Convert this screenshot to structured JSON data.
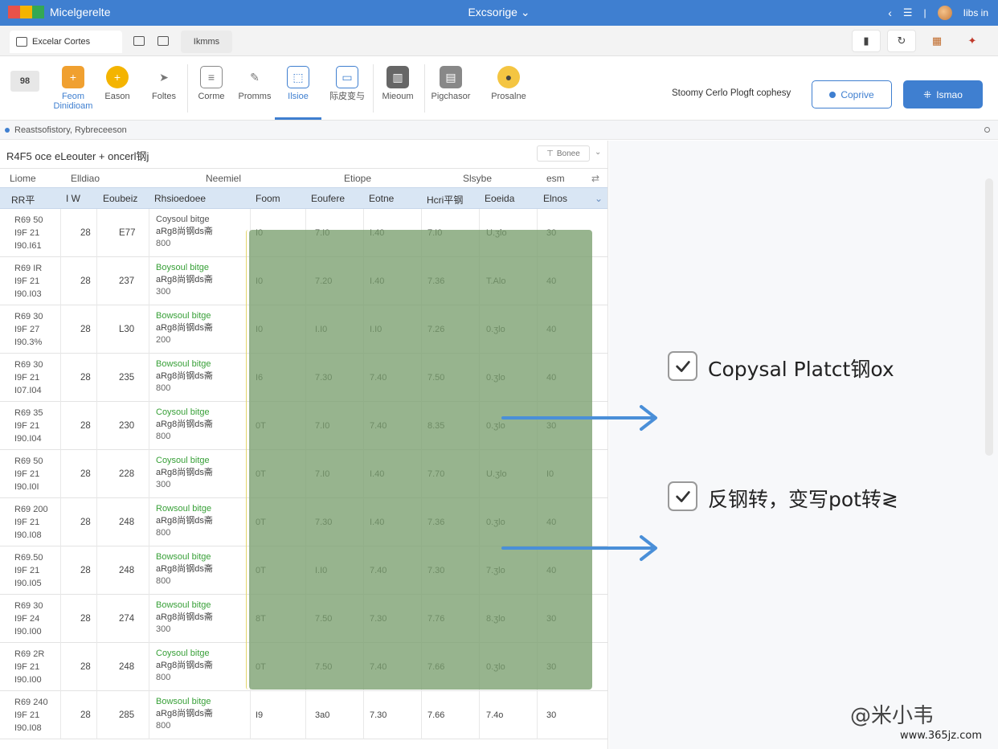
{
  "app": {
    "name": "Micelgerelte",
    "window_title": "Excsorige",
    "user": "Iibs in"
  },
  "colors": {
    "accent": "#3f7fd0",
    "highlight": "#7a9f6e",
    "link_green": "#38a038"
  },
  "tabbar": {
    "doc_tab": "Excelar Cortes",
    "tab2": "Ikmms"
  },
  "ribbon": {
    "items": [
      {
        "label": "Feom Dinidioam",
        "icon": "plus-square-icon"
      },
      {
        "label": "Eason",
        "icon": "plus-circle-icon"
      },
      {
        "label": "Foltes",
        "icon": "arrow-icon"
      },
      {
        "label": "Corme",
        "icon": "document-icon"
      },
      {
        "label": "Promms",
        "icon": "tag-icon"
      },
      {
        "label": "Ilsioe",
        "icon": "frame-icon"
      },
      {
        "label": "际皮变与",
        "icon": "box-icon"
      },
      {
        "label": "Mieoum",
        "icon": "grid-icon"
      },
      {
        "label": "Pigchasor",
        "icon": "stack-icon"
      },
      {
        "label": "Prosalne",
        "icon": "coin-icon"
      }
    ],
    "status": "Stoomy Cerlo Plogft cophesy",
    "copy_button": "Coprive",
    "primary_button": "Ismao"
  },
  "infobar": {
    "text": "Reastsofistory, Rybreceeson"
  },
  "sheet": {
    "title": "R4F5 oce eLeouter + oncerl钢j",
    "filter": "Bonee",
    "groups": [
      "Liome",
      "Elldiao",
      "Neemiel",
      "Etiope",
      "Slsybe",
      "esm"
    ],
    "headers": [
      "RR平",
      "I W",
      "Eoubeiz",
      "Rhsioedoee",
      "Foom",
      "Eoufere",
      "Eotne",
      "Hcri平钢",
      "Eoeida",
      "Elnos"
    ],
    "rows": [
      {
        "id1": "R69 50",
        "id2": "I9F  21",
        "id3": "I90.I61",
        "n": "28",
        "e": "E77",
        "d1": "Coysoul bitge",
        "d2": "aRg8尚钢ds斋",
        "d3": "800",
        "v": [
          "I0",
          "7.I0",
          "I.40",
          "7.I0",
          "U.ʒlo",
          "30"
        ]
      },
      {
        "id1": "R69 IR",
        "id2": "I9F  21",
        "id3": "I90.I03",
        "n": "28",
        "e": "237",
        "d1": "Boysoul bitge",
        "d2": "aRg8尚钢ds斋",
        "d3": "300",
        "v": [
          "I0",
          "7.20",
          "I.40",
          "7.36",
          "T.Alo",
          "40"
        ]
      },
      {
        "id1": "R69 30",
        "id2": "I9F  27",
        "id3": "I90.3%",
        "n": "28",
        "e": "L30",
        "d1": "Bowsoul bitge",
        "d2": "aRg8尚钢ds斋",
        "d3": "200",
        "v": [
          "I0",
          "I.I0",
          "I.I0",
          "7.26",
          "0.ʒlo",
          "40"
        ]
      },
      {
        "id1": "R69 30",
        "id2": "I9F  21",
        "id3": "I07.I04",
        "n": "28",
        "e": "235",
        "d1": "Bowsoul bitge",
        "d2": "aRg8尚钢ds斋",
        "d3": "800",
        "v": [
          "I6",
          "7.30",
          "7.40",
          "7.50",
          "0.ʒlo",
          "40"
        ]
      },
      {
        "id1": "R69 35",
        "id2": "I9F  21",
        "id3": "I90.I04",
        "n": "28",
        "e": "230",
        "d1": "Coysoul bitge",
        "d2": "aRg8尚钢ds斋",
        "d3": "800",
        "v": [
          "0T",
          "7.I0",
          "7.40",
          "8.35",
          "0.ʒlo",
          "30"
        ]
      },
      {
        "id1": "R69 50",
        "id2": "I9F  21",
        "id3": "I90.I0I",
        "n": "28",
        "e": "228",
        "d1": "Coysoul bitge",
        "d2": "aRg8尚钢ds斋",
        "d3": "300",
        "v": [
          "0T",
          "7.I0",
          "I.40",
          "7.70",
          "U.ʒlo",
          "I0"
        ]
      },
      {
        "id1": "R69 200",
        "id2": "I9F  21",
        "id3": "I90.I08",
        "n": "28",
        "e": "248",
        "d1": "Rowsoul bitge",
        "d2": "aRg8尚钢ds斋",
        "d3": "800",
        "v": [
          "0T",
          "7.30",
          "I.40",
          "7.36",
          "0.ʒlo",
          "40"
        ]
      },
      {
        "id1": "R69.50",
        "id2": "I9F  21",
        "id3": "I90.I05",
        "n": "28",
        "e": "248",
        "d1": "Bowsoul bitge",
        "d2": "aRg8尚钢ds斋",
        "d3": "800",
        "v": [
          "0T",
          "I.I0",
          "7.40",
          "7.30",
          "7.ʒlo",
          "40"
        ]
      },
      {
        "id1": "R69 30",
        "id2": "I9F  24",
        "id3": "I90.I00",
        "n": "28",
        "e": "274",
        "d1": "Bowsoul bitge",
        "d2": "aRg8尚钢ds斋",
        "d3": "300",
        "v": [
          "8T",
          "7.50",
          "7.30",
          "7.76",
          "8.ʒlo",
          "30"
        ]
      },
      {
        "id1": "R69 2R",
        "id2": "I9F  21",
        "id3": "I90.I00",
        "n": "28",
        "e": "248",
        "d1": "Coysoul bitge",
        "d2": "aRg8尚钢ds斋",
        "d3": "800",
        "v": [
          "0T",
          "7.50",
          "7.40",
          "7.66",
          "0.ʒlo",
          "30"
        ]
      },
      {
        "id1": "R69 240",
        "id2": "I9F  21",
        "id3": "I90.I08",
        "n": "28",
        "e": "285",
        "d1": "Bowsoul bitge",
        "d2": "aRg8尚钢ds斋",
        "d3": "800",
        "v": [
          "I9",
          "3a0",
          "7.30",
          "7.66",
          "7.4o",
          "30"
        ]
      }
    ]
  },
  "annotations": [
    {
      "label": "Copysal Platct钢ox"
    },
    {
      "label": "反钢转，变写pot转≷"
    }
  ],
  "watermark": {
    "text": "@米小韦",
    "url": "www.365jz.com"
  }
}
